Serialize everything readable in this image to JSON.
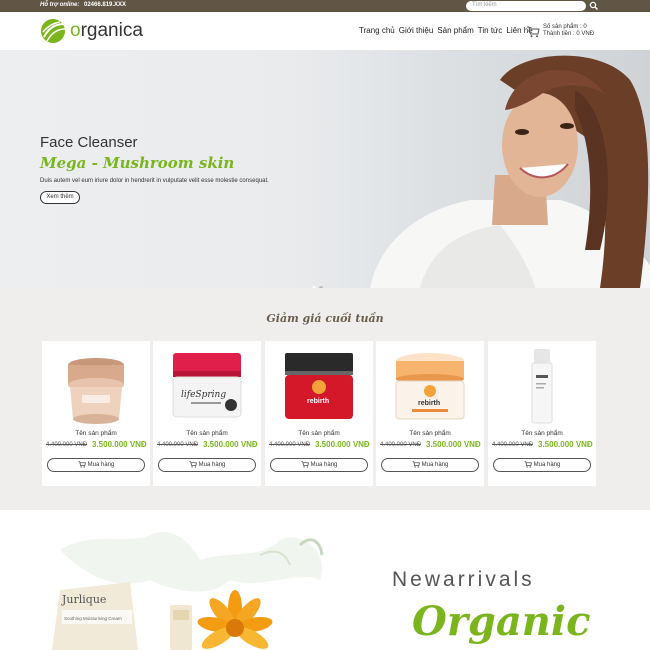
{
  "topbar": {
    "support_label": "Hỗ trợ online:",
    "phone": "02466.819.XXX",
    "search_placeholder": "Tìm kiếm",
    "search_icon": "search-icon"
  },
  "header": {
    "logo_text_o": "o",
    "logo_text_rest": "rganica",
    "nav": [
      "Trang chủ",
      "Giới thiệu",
      "Sản phẩm",
      "Tin tức",
      "Liên hệ"
    ],
    "cart_count_label": "Số sản phẩm : 0",
    "cart_total_label": "Thành tiền : 0 VNĐ"
  },
  "hero": {
    "title": "Face Cleanser",
    "subtitle": "Mega - Mushroom skin",
    "description": "Duis autem vel eum iriure dolor in hendrerit in vulputate velit esse molestie consequat.",
    "button_label": "Xem thêm",
    "slide_count": 2,
    "active_slide": 1
  },
  "deals": {
    "section_title": "Giảm giá cuối tuần",
    "products": [
      {
        "name": "Tên sản phẩm",
        "old_price": "4.400.000 VNĐ",
        "price": "3.500.000 VNĐ",
        "buy_label": "Mua hàng",
        "image": "himalaya-cream-jar"
      },
      {
        "name": "Tên sản phẩm",
        "old_price": "4.400.000 VNĐ",
        "price": "3.500.000 VNĐ",
        "buy_label": "Mua hàng",
        "image": "lifespring-placenta-jar"
      },
      {
        "name": "Tên sản phẩm",
        "old_price": "4.400.000 VNĐ",
        "price": "3.500.000 VNĐ",
        "buy_label": "Mua hàng",
        "image": "rebirth-red-jar"
      },
      {
        "name": "Tên sản phẩm",
        "old_price": "4.400.000 VNĐ",
        "price": "3.500.000 VNĐ",
        "buy_label": "Mua hàng",
        "image": "rebirth-orange-jar"
      },
      {
        "name": "Tên sản phẩm",
        "old_price": "4.400.000 VNĐ",
        "price": "3.500.000 VNĐ",
        "buy_label": "Mua hàng",
        "image": "serum-bottle"
      }
    ]
  },
  "arrivals": {
    "heading": "Newarrivals",
    "subheading": "Organic",
    "brand_on_tube": "Jurlique",
    "tube_label": "Soothing Moisturising Cream"
  },
  "colors": {
    "accent_green": "#7ab51d",
    "topbar_brown": "#615646",
    "section_title_brown": "#6b5e4d"
  }
}
